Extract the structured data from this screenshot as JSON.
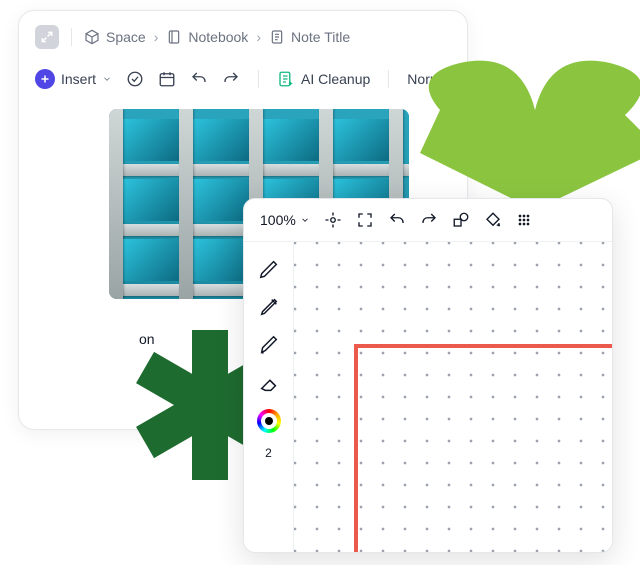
{
  "note": {
    "breadcrumb": {
      "space": "Space",
      "notebook": "Notebook",
      "title": "Note Title"
    },
    "toolbar": {
      "insert": "Insert",
      "ai_cleanup": "AI Cleanup",
      "text_style": "Norma"
    },
    "body_text": "on"
  },
  "canvas": {
    "zoom": "100%",
    "stroke_width": "2"
  }
}
